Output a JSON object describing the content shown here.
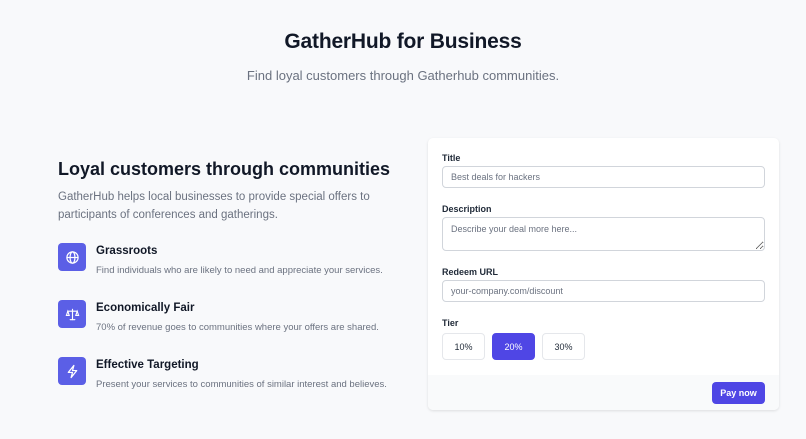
{
  "header": {
    "title": "GatherHub for Business",
    "subtitle": "Find loyal customers through Gatherhub communities."
  },
  "intro": {
    "title": "Loyal customers through communities",
    "description": "GatherHub helps local businesses to provide special offers to participants of conferences and gatherings."
  },
  "features": [
    {
      "icon": "globe-icon",
      "title": "Grassroots",
      "description": "Find individuals who are likely to need and appreciate your services."
    },
    {
      "icon": "scale-icon",
      "title": "Economically Fair",
      "description": "70% of revenue goes to communities where your offers are shared."
    },
    {
      "icon": "lightning-icon",
      "title": "Effective Targeting",
      "description": "Present your services to communities of similar interest and believes."
    }
  ],
  "form": {
    "title_label": "Title",
    "title_placeholder": "Best deals for hackers",
    "description_label": "Description",
    "description_placeholder": "Describe your deal more here...",
    "url_label": "Redeem URL",
    "url_placeholder": "your-company.com/discount",
    "tier_label": "Tier",
    "tiers": [
      "10%",
      "20%",
      "30%"
    ],
    "selected_tier": "20%",
    "submit_label": "Pay now"
  },
  "colors": {
    "accent": "#4f46e5",
    "icon_bg": "#5b5fe6",
    "page_bg": "#f8f9fb"
  }
}
